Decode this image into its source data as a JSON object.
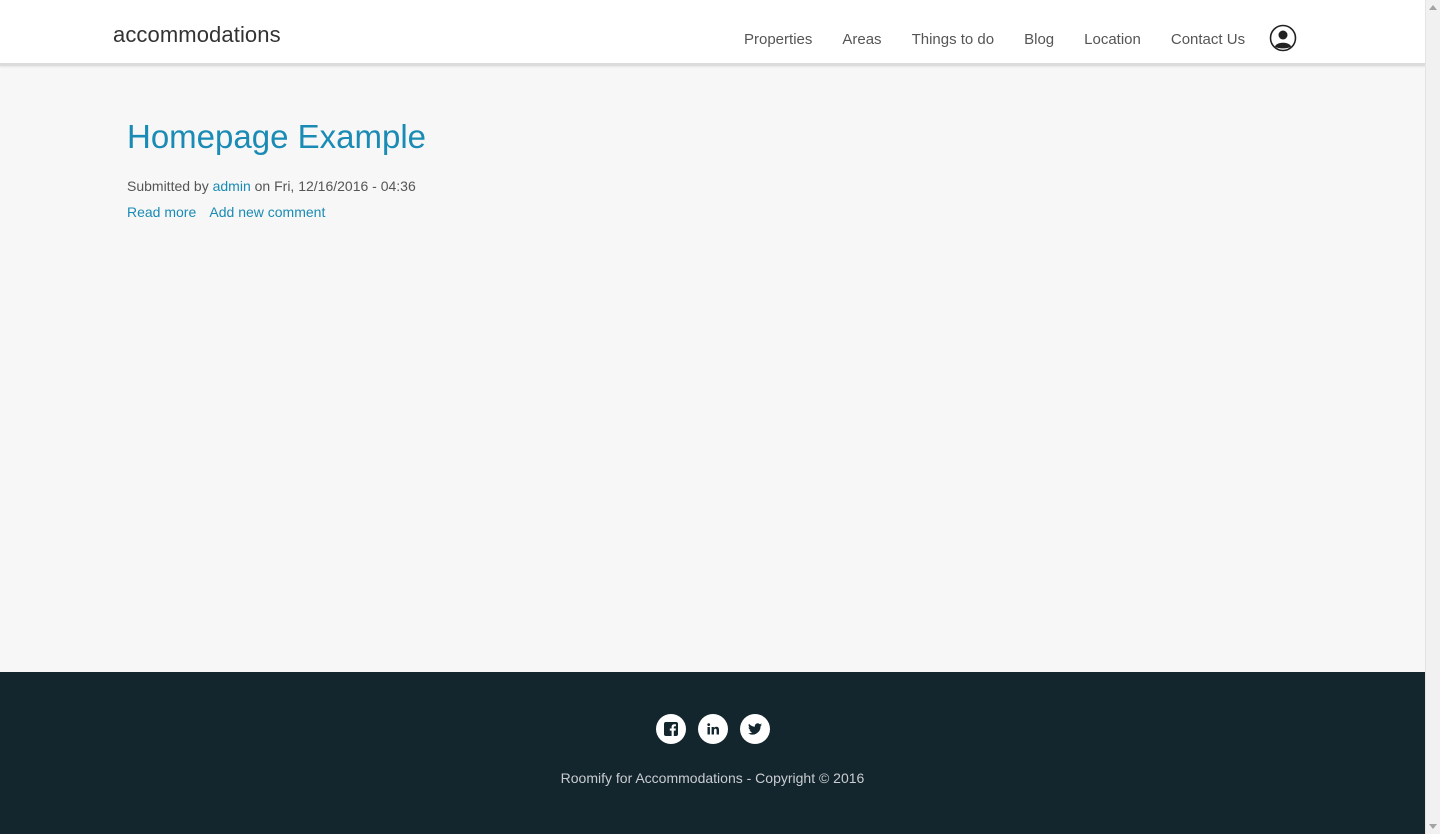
{
  "header": {
    "site_name": "accommodations",
    "nav": [
      "Properties",
      "Areas",
      "Things to do",
      "Blog",
      "Location",
      "Contact Us"
    ],
    "user_icon": "user-circle-icon"
  },
  "article": {
    "title": "Homepage Example",
    "submitted_prefix": "Submitted by",
    "author": "admin",
    "submitted_on": "on Fri, 12/16/2016 - 04:36",
    "read_more": "Read more",
    "add_comment": "Add new comment"
  },
  "footer": {
    "social": [
      "facebook-icon",
      "linkedin-icon",
      "twitter-icon"
    ],
    "copyright": "Roomify for Accommodations - Copyright © 2016"
  },
  "colors": {
    "link": "#1a8bb4",
    "footer_bg": "#13252d",
    "page_bg": "#f7f7f7"
  }
}
